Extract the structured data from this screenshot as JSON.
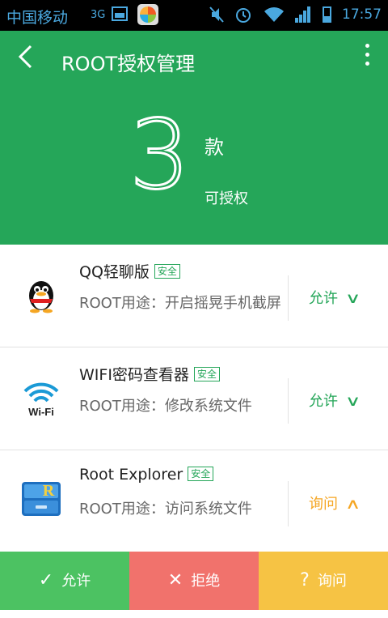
{
  "status_bar": {
    "carrier": "中国移动",
    "network": "3G",
    "time": "17:57",
    "icons": [
      "picture-icon",
      "app-store-icon",
      "mute-icon",
      "alarm-icon",
      "wifi-icon",
      "signal-icon",
      "battery-icon"
    ]
  },
  "header": {
    "title": "ROOT授权管理",
    "count": "3",
    "unit": "款",
    "subtitle": "可授权"
  },
  "apps": [
    {
      "name": "QQ轻聊版",
      "badge": "安全",
      "usage": "ROOT用途：开启摇晃手机截屏",
      "action": "允许",
      "action_color": "#25a659",
      "chevron": "down"
    },
    {
      "name": "WIFI密码查看器",
      "badge": "安全",
      "usage": "ROOT用途：修改系统文件",
      "action": "允许",
      "action_color": "#25a659",
      "chevron": "down"
    },
    {
      "name": "Root Explorer",
      "badge": "安全",
      "usage": "ROOT用途：访问系统文件",
      "action": "询问",
      "action_color": "#f5a623",
      "chevron": "up"
    }
  ],
  "bottom_bar": {
    "allow": {
      "icon": "✓",
      "label": "允许",
      "color": "#4cc262"
    },
    "deny": {
      "icon": "✕",
      "label": "拒绝",
      "color": "#f1726c"
    },
    "ask": {
      "icon": "?",
      "label": "询问",
      "color": "#f6c344"
    }
  },
  "colors": {
    "primary": "#25a659",
    "warning": "#f5a623"
  }
}
